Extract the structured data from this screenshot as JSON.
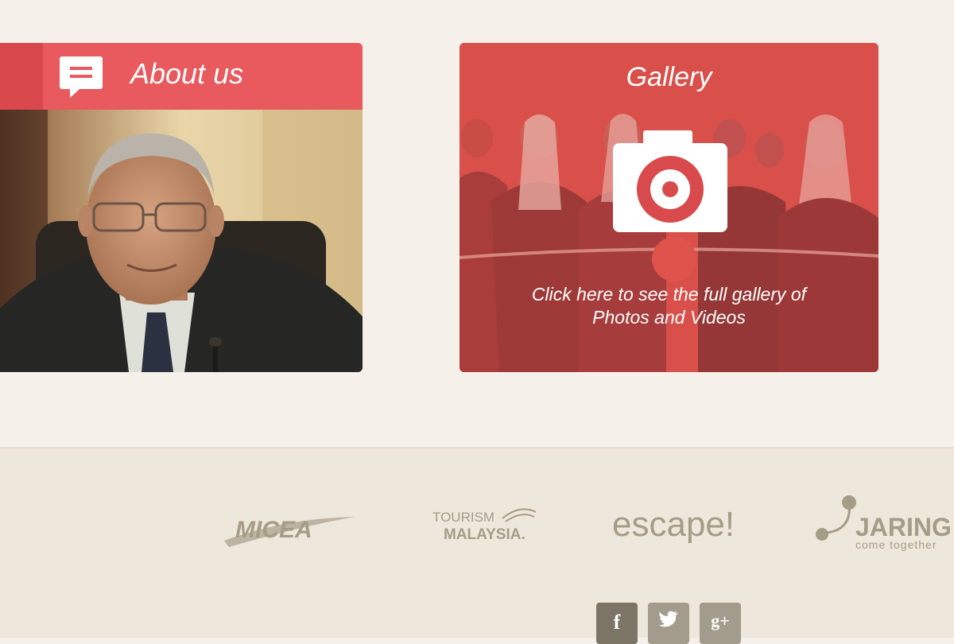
{
  "about": {
    "title": "About us",
    "icon": "chat-bubble-icon",
    "header_color": "#e85a5e"
  },
  "gallery": {
    "title": "Gallery",
    "caption_line1": "Click here to see the full gallery of",
    "caption_line2": "Photos and Videos",
    "icon": "camera-icon",
    "overlay_color": "#d85049"
  },
  "partners": {
    "micea": "MICEA",
    "tourism_malaysia_line1": "TOURISM",
    "tourism_malaysia_line2": "MALAYSIA.",
    "escape": "escape!",
    "jaring_name": "JARING",
    "jaring_tagline": "come together"
  },
  "social": {
    "facebook": "f",
    "twitter": "twitter-icon",
    "google_plus": "g+"
  }
}
